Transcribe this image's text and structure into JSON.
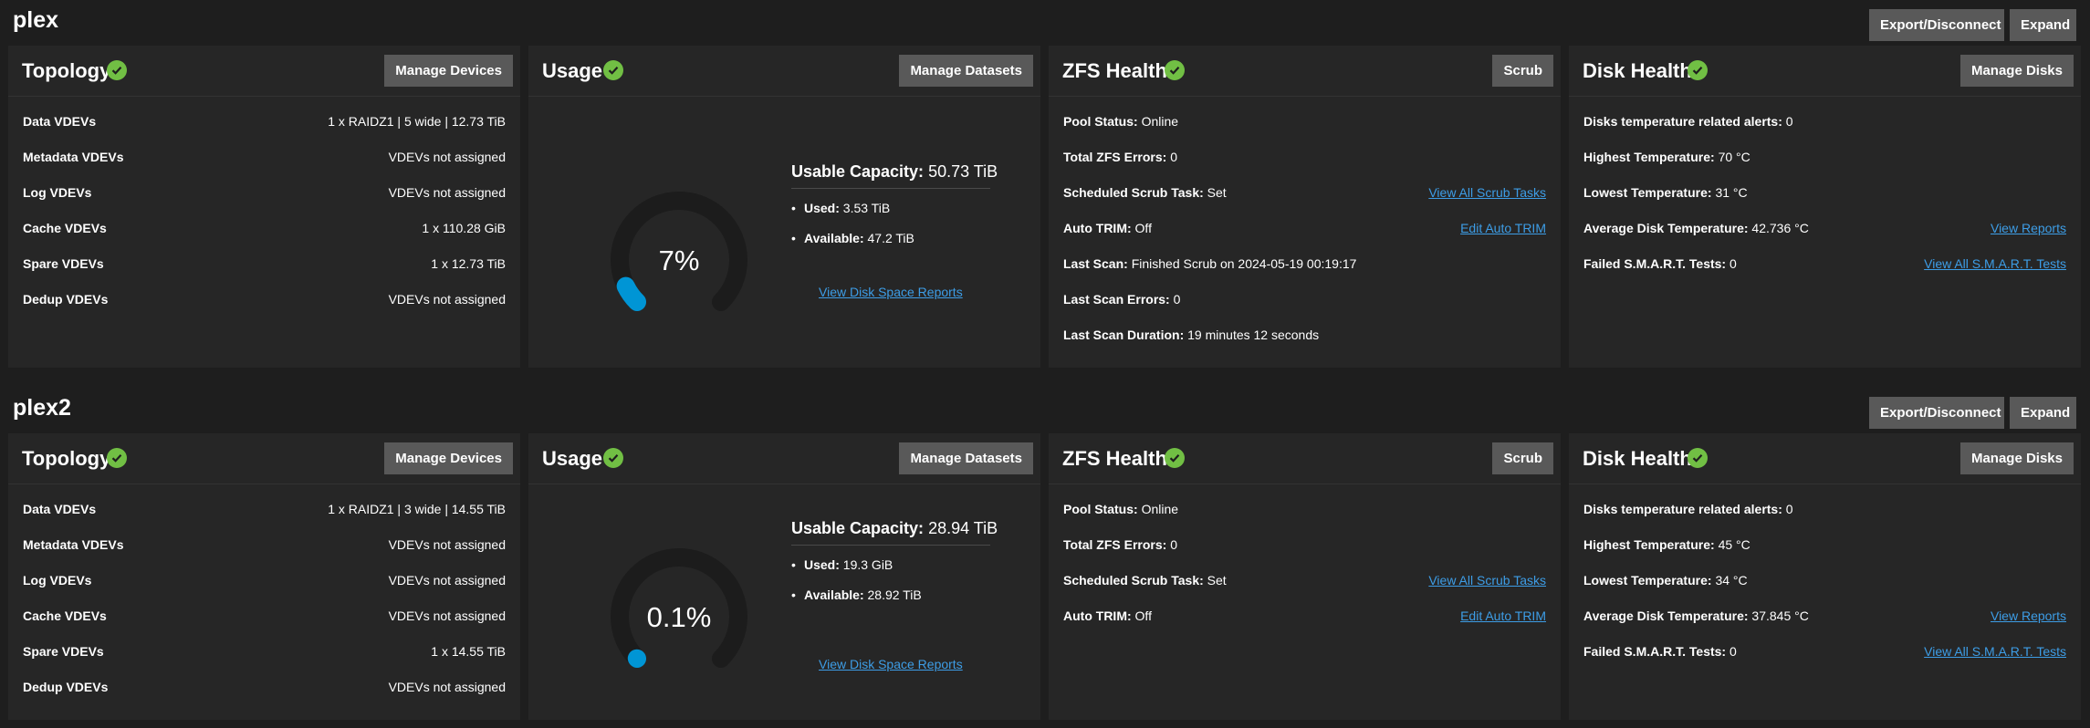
{
  "common": {
    "export_label": "Export/Disconnect",
    "expand_label": "Expand",
    "topology_title": "Topology",
    "usage_title": "Usage",
    "zfs_title": "ZFS Health",
    "disk_title": "Disk Health",
    "manage_devices": "Manage Devices",
    "manage_datasets": "Manage Datasets",
    "scrub": "Scrub",
    "manage_disks": "Manage Disks",
    "usable_capacity_label": "Usable Capacity:",
    "used_label": "Used:",
    "available_label": "Available:",
    "view_disk_space_reports": "View Disk Space Reports",
    "view_all_scrub_tasks": "View All Scrub Tasks",
    "edit_auto_trim": "Edit Auto TRIM",
    "view_reports": "View Reports",
    "view_all_smart": "View All S.M.A.R.T. Tests",
    "colors": {
      "ok": "#71bf44",
      "accent": "#0095d5",
      "link": "#3d9de6",
      "button": "#595959"
    }
  },
  "pools": [
    {
      "name": "plex",
      "topology": [
        {
          "label": "Data VDEVs",
          "value": "1 x RAIDZ1 | 5 wide | 12.73 TiB"
        },
        {
          "label": "Metadata VDEVs",
          "value": "VDEVs not assigned"
        },
        {
          "label": "Log VDEVs",
          "value": "VDEVs not assigned"
        },
        {
          "label": "Cache VDEVs",
          "value": "1 x 110.28 GiB"
        },
        {
          "label": "Spare VDEVs",
          "value": "1 x 12.73 TiB"
        },
        {
          "label": "Dedup VDEVs",
          "value": "VDEVs not assigned"
        }
      ],
      "usage": {
        "percent_text": "7%",
        "percent": 7,
        "usable_capacity": "50.73 TiB",
        "used": "3.53 TiB",
        "available": "47.2 TiB"
      },
      "zfs": [
        {
          "label": "Pool Status:",
          "value": "Online"
        },
        {
          "label": "Total ZFS Errors:",
          "value": "0"
        },
        {
          "label": "Scheduled Scrub Task:",
          "value": "Set"
        },
        {
          "label": "Auto TRIM:",
          "value": "Off"
        },
        {
          "label": "Last Scan:",
          "value": "Finished Scrub on 2024-05-19 00:19:17"
        },
        {
          "label": "Last Scan Errors:",
          "value": "0"
        },
        {
          "label": "Last Scan Duration:",
          "value": "19 minutes 12 seconds"
        }
      ],
      "disk": [
        {
          "label": "Disks temperature related alerts:",
          "value": "0"
        },
        {
          "label": "Highest Temperature:",
          "value": "70 °C"
        },
        {
          "label": "Lowest Temperature:",
          "value": "31 °C"
        },
        {
          "label": "Average Disk Temperature:",
          "value": "42.736 °C"
        },
        {
          "label": "Failed S.M.A.R.T. Tests:",
          "value": "0"
        }
      ]
    },
    {
      "name": "plex2",
      "topology": [
        {
          "label": "Data VDEVs",
          "value": "1 x RAIDZ1 | 3 wide | 14.55 TiB"
        },
        {
          "label": "Metadata VDEVs",
          "value": "VDEVs not assigned"
        },
        {
          "label": "Log VDEVs",
          "value": "VDEVs not assigned"
        },
        {
          "label": "Cache VDEVs",
          "value": "VDEVs not assigned"
        },
        {
          "label": "Spare VDEVs",
          "value": "1 x 14.55 TiB"
        },
        {
          "label": "Dedup VDEVs",
          "value": "VDEVs not assigned"
        }
      ],
      "usage": {
        "percent_text": "0.1%",
        "percent": 0.1,
        "usable_capacity": "28.94 TiB",
        "used": "19.3 GiB",
        "available": "28.92 TiB"
      },
      "zfs": [
        {
          "label": "Pool Status:",
          "value": "Online"
        },
        {
          "label": "Total ZFS Errors:",
          "value": "0"
        },
        {
          "label": "Scheduled Scrub Task:",
          "value": "Set"
        },
        {
          "label": "Auto TRIM:",
          "value": "Off"
        }
      ],
      "disk": [
        {
          "label": "Disks temperature related alerts:",
          "value": "0"
        },
        {
          "label": "Highest Temperature:",
          "value": "45 °C"
        },
        {
          "label": "Lowest Temperature:",
          "value": "34 °C"
        },
        {
          "label": "Average Disk Temperature:",
          "value": "37.845 °C"
        },
        {
          "label": "Failed S.M.A.R.T. Tests:",
          "value": "0"
        }
      ]
    }
  ]
}
